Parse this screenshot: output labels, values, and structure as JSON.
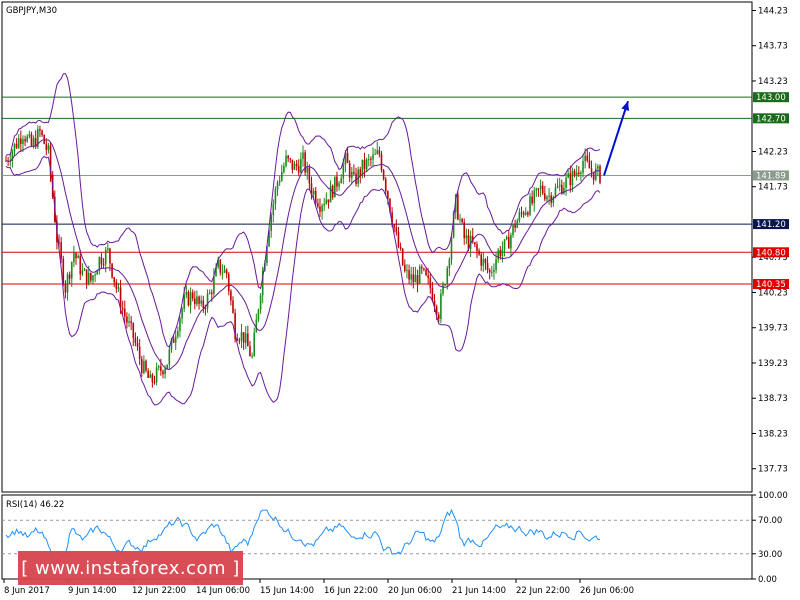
{
  "chart_data": [
    {
      "type": "candlestick",
      "title": "GBPJPY,M30",
      "ylim": [
        137.4,
        144.35
      ],
      "y_ticks": [
        "144.23",
        "143.73",
        "143.23",
        "142.23",
        "141.73",
        "140.73",
        "140.23",
        "139.73",
        "139.23",
        "138.73",
        "138.23",
        "137.73"
      ],
      "x_ticks": [
        "8 Jun 2017",
        "9 Jun 14:00",
        "12 Jun 22:00",
        "14 Jun 06:00",
        "15 Jun 14:00",
        "16 Jun 22:00",
        "20 Jun 06:00",
        "21 Jun 14:00",
        "22 Jun 22:00",
        "26 Jun 06:00"
      ],
      "price_path": [
        [
          0,
          142.1
        ],
        [
          2,
          142.5
        ],
        [
          3,
          142.3
        ],
        [
          4,
          142.5
        ],
        [
          5,
          142.2
        ],
        [
          6,
          141.0
        ],
        [
          7,
          140.3
        ],
        [
          8,
          140.8
        ],
        [
          9,
          140.5
        ],
        [
          10,
          140.4
        ],
        [
          11,
          140.7
        ],
        [
          12,
          140.8
        ],
        [
          13,
          140.3
        ],
        [
          14,
          139.9
        ],
        [
          15,
          139.6
        ],
        [
          16,
          139.2
        ],
        [
          17,
          138.95
        ],
        [
          18,
          139.1
        ],
        [
          19,
          139.25
        ],
        [
          20,
          139.7
        ],
        [
          21,
          140.1
        ],
        [
          22,
          140.2
        ],
        [
          23,
          140.0
        ],
        [
          24,
          140.2
        ],
        [
          25,
          140.6
        ],
        [
          26,
          140.5
        ],
        [
          27,
          139.7
        ],
        [
          28,
          139.6
        ],
        [
          29,
          139.3
        ],
        [
          30,
          140.3
        ],
        [
          31,
          141.2
        ],
        [
          32,
          141.8
        ],
        [
          33,
          142.1
        ],
        [
          34,
          142.0
        ],
        [
          35,
          142.1
        ],
        [
          36,
          141.7
        ],
        [
          37,
          141.5
        ],
        [
          38,
          141.6
        ],
        [
          39,
          141.8
        ],
        [
          40,
          142.1
        ],
        [
          41,
          141.8
        ],
        [
          42,
          142.0
        ],
        [
          43,
          142.1
        ],
        [
          44,
          142.2
        ],
        [
          45,
          141.6
        ],
        [
          46,
          141.0
        ],
        [
          47,
          140.5
        ],
        [
          48,
          140.4
        ],
        [
          49,
          140.5
        ],
        [
          50,
          140.3
        ],
        [
          51,
          139.95
        ],
        [
          52,
          140.6
        ],
        [
          53,
          141.5
        ],
        [
          54,
          141.0
        ],
        [
          55,
          140.9
        ],
        [
          56,
          140.7
        ],
        [
          57,
          140.5
        ],
        [
          58,
          140.8
        ],
        [
          59,
          140.9
        ],
        [
          60,
          141.2
        ],
        [
          61,
          141.4
        ],
        [
          62,
          141.5
        ],
        [
          63,
          141.7
        ],
        [
          64,
          141.6
        ],
        [
          65,
          141.7
        ],
        [
          66,
          141.8
        ],
        [
          67,
          141.9
        ],
        [
          68,
          142.1
        ],
        [
          69,
          141.95
        ],
        [
          70,
          141.89
        ]
      ],
      "levels": [
        {
          "price": 143.0,
          "label": "143.00",
          "color": "#1a6b1a"
        },
        {
          "price": 142.7,
          "label": "142.70",
          "color": "#1a6b1a"
        },
        {
          "price": 141.89,
          "label": "141.89",
          "color": "#8c9a8c"
        },
        {
          "price": 141.2,
          "label": "141.20",
          "color": "#0a1650"
        },
        {
          "price": 140.8,
          "label": "140.80",
          "color": "#e00000"
        },
        {
          "price": 140.35,
          "label": "140.35",
          "color": "#e00000"
        }
      ],
      "forecast_arrow": {
        "from_price": 141.89,
        "to_price": 143.0,
        "color": "#0010d0"
      }
    },
    {
      "type": "line",
      "title": "RSI(14) 46.22",
      "ylim": [
        0,
        100
      ],
      "y_ticks": [
        "100.00",
        "70.00",
        "30.00",
        "0.00"
      ],
      "levels": [
        70,
        30
      ]
    }
  ],
  "watermark": "[ www.instaforex.com ]"
}
